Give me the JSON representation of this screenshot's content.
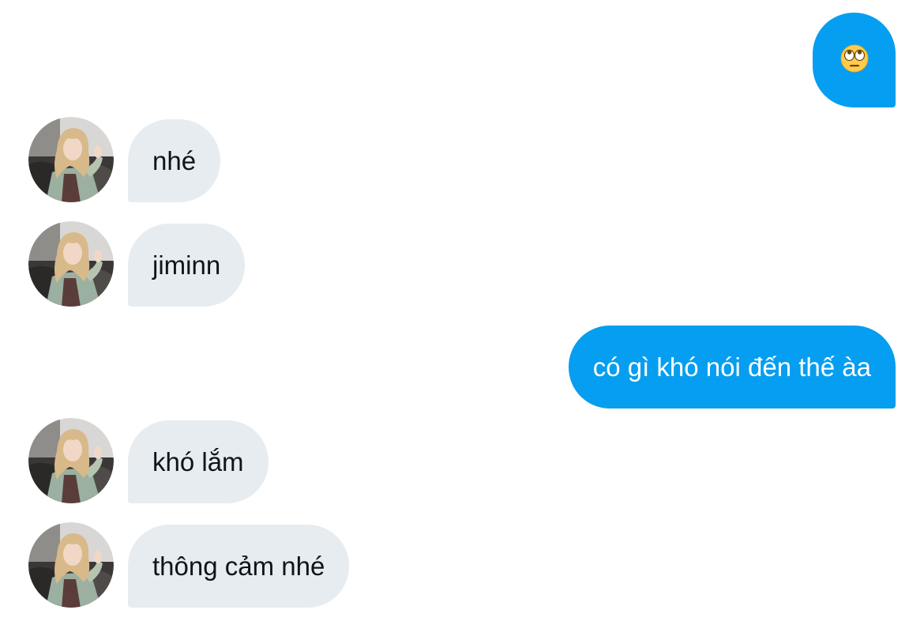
{
  "conversation": {
    "messages": [
      {
        "sender": "me",
        "text": "🙄",
        "emoji_name": "face-with-rolling-eyes"
      },
      {
        "sender": "them",
        "text": "nhé"
      },
      {
        "sender": "them",
        "text": "jiminn"
      },
      {
        "sender": "me",
        "text": "có gì khó nói đến thế àa"
      },
      {
        "sender": "them",
        "text": "khó lắm"
      },
      {
        "sender": "them",
        "text": "thông cảm nhé"
      }
    ]
  },
  "colors": {
    "outgoing_bubble": "#069ef0",
    "incoming_bubble": "#e7ecf0",
    "incoming_text": "#0f1419",
    "outgoing_text": "#ffffff"
  }
}
